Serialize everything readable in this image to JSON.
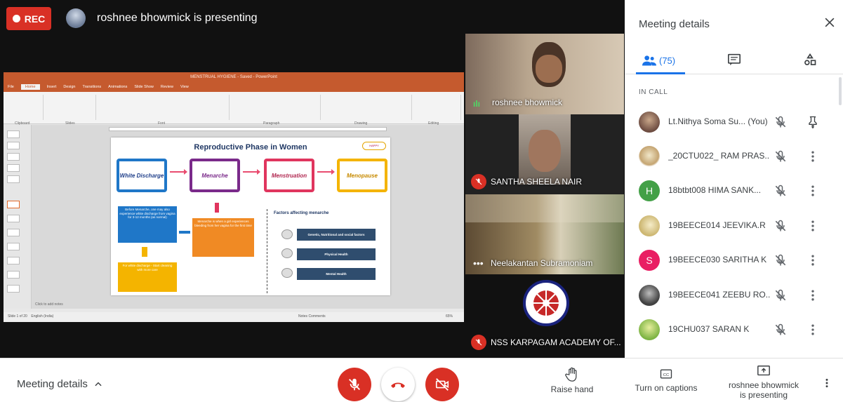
{
  "recording": {
    "label": "REC"
  },
  "presenter": {
    "banner": "roshnee bhowmick is presenting"
  },
  "powerpoint": {
    "title_text": "MENSTRUAL HYGIENE - Saved - PowerPoint",
    "tabs": [
      "File",
      "Home",
      "Insert",
      "Design",
      "Transitions",
      "Animations",
      "Slide Show",
      "Review",
      "View"
    ],
    "active_tab": "Home",
    "ribbon_groups": [
      "Clipboard",
      "Slides",
      "Font",
      "Paragraph",
      "Drawing",
      "Editing"
    ],
    "notes_placeholder": "Click to add notes",
    "status_left": "Slide 1 of 20",
    "status_lang": "English (India)",
    "status_right": "Notes   Comments",
    "zoom": "65%"
  },
  "slide": {
    "title": "Reproductive Phase in Women",
    "logo_text": "HAPPY",
    "stages": [
      "White Discharge",
      "Menarche",
      "Menstruation",
      "Menopause"
    ],
    "stage_colors": [
      "#1f77c8",
      "#7a2a8a",
      "#e0355e",
      "#f4b400"
    ],
    "box_blue_text": "Before Menarche, one may also experience white discharge from vagina for 3-12 months (as normal)",
    "box_orange_text": "Menarche is when a girl experiences bleeding from her vagina for the first time",
    "box_yellow_text": "For white discharge - Start cleaning with more care",
    "factors_title": "Factors affecting menarche",
    "factors": [
      "Genetic, Nutritional and social factors",
      "Physical Health",
      "Mental Health"
    ]
  },
  "tiles": [
    {
      "name": "roshnee bhowmick",
      "muted": false,
      "speaking": true
    },
    {
      "name": "SANTHA SHEELA NAIR",
      "muted": true
    },
    {
      "name": "Neelakantan Subramoniam",
      "muted": false
    },
    {
      "name": "NSS KARPAGAM ACADEMY OF...",
      "muted": true
    }
  ],
  "bottom": {
    "meeting_details": "Meeting details",
    "raise_hand": "Raise hand",
    "captions": "Turn on captions",
    "presenting_line1": "roshnee bhowmick",
    "presenting_line2": "is presenting"
  },
  "sidebar": {
    "title": "Meeting details",
    "people_count": "(75)",
    "section": "IN CALL",
    "participants": [
      {
        "name": "Lt.Nithya Soma Su...",
        "you": "(You)",
        "avatar_color": "#8d6e63"
      },
      {
        "name": "_20CTU022_ RAM PRAS...",
        "avatar_color": "#c5a572"
      },
      {
        "name": "18btbt008 HIMA SANK...",
        "initial": "H",
        "avatar_color": "#43a047"
      },
      {
        "name": "19BEECE014 JEEVIKA.R",
        "avatar_color": "#d8c48a"
      },
      {
        "name": "19BEECE030 SARITHA K",
        "initial": "S",
        "avatar_color": "#e91e63"
      },
      {
        "name": "19BEECE041 ZEEBU RO...",
        "avatar_color": "#555555"
      },
      {
        "name": "19CHU037 SARAN K",
        "avatar_color": "#9ccc65"
      }
    ]
  },
  "colors": {
    "accent": "#1a73e8",
    "danger": "#d93025",
    "ppt_orange": "#c55a2e"
  }
}
